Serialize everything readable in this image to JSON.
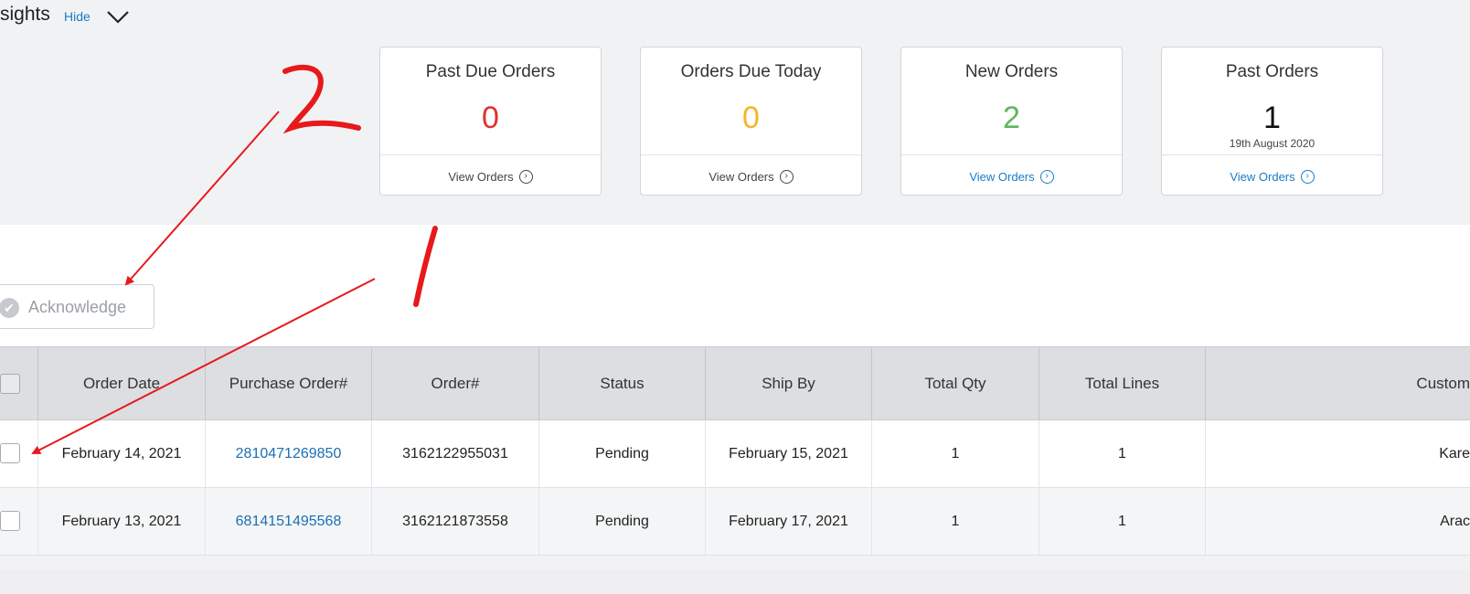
{
  "insights": {
    "title": "sights",
    "hide_label": "Hide"
  },
  "cards": [
    {
      "title": "Past Due Orders",
      "value": "0",
      "value_color": "#e0322b",
      "subtitle": "",
      "link": "View Orders"
    },
    {
      "title": "Orders Due Today",
      "value": "0",
      "value_color": "#f5b52a",
      "subtitle": "",
      "link": "View Orders"
    },
    {
      "title": "New Orders",
      "value": "2",
      "value_color": "#5cb85c",
      "subtitle": "",
      "link": "View Orders"
    },
    {
      "title": "Past Orders",
      "value": "1",
      "value_color": "#111111",
      "subtitle": "19th August 2020",
      "link": "View Orders"
    }
  ],
  "toolbar": {
    "acknowledge_label": "Acknowledge"
  },
  "table": {
    "columns": [
      "Order Date",
      "Purchase Order#",
      "Order#",
      "Status",
      "Ship By",
      "Total Qty",
      "Total Lines",
      "Custom"
    ],
    "rows": [
      {
        "order_date": "February 14, 2021",
        "po": "2810471269850",
        "order": "3162122955031",
        "status": "Pending",
        "ship_by": "February 15, 2021",
        "qty": "1",
        "lines": "1",
        "customer": "Kare"
      },
      {
        "order_date": "February 13, 2021",
        "po": "6814151495568",
        "order": "3162121873558",
        "status": "Pending",
        "ship_by": "February 17, 2021",
        "qty": "1",
        "lines": "1",
        "customer": "Arac"
      }
    ]
  },
  "annotations": {
    "label_1": "1",
    "label_2": "2",
    "color": "#e8191b"
  },
  "colors": {
    "link_blue": "#1a7bc4"
  }
}
